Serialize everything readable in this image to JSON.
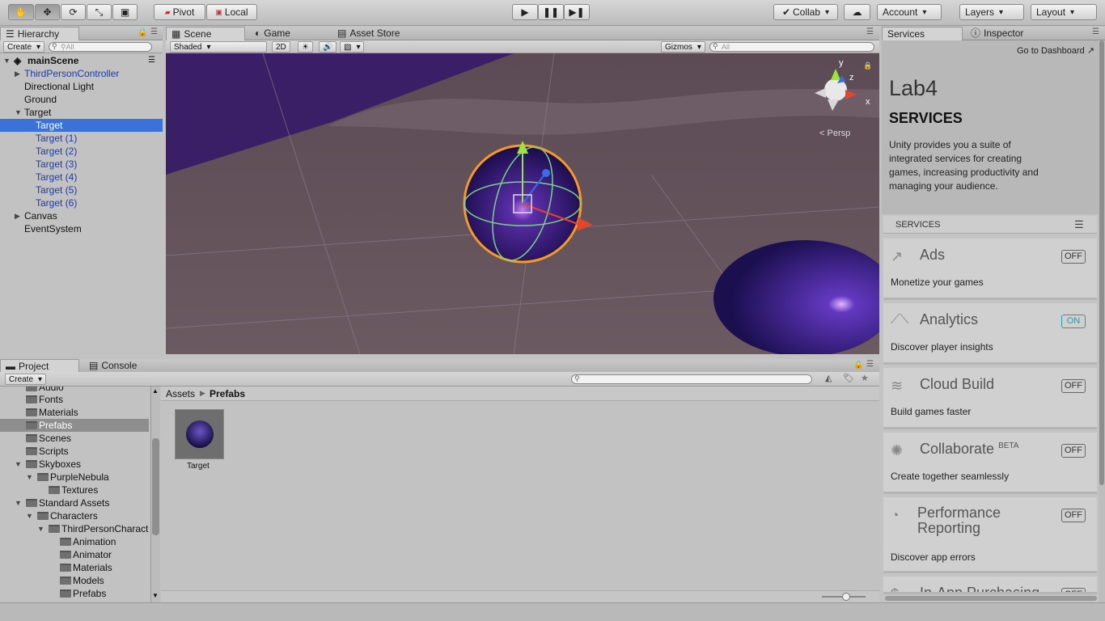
{
  "toolbar": {
    "pivot": "Pivot",
    "local": "Local",
    "collab": "Collab",
    "account": "Account",
    "layers": "Layers",
    "layout": "Layout"
  },
  "hierarchy": {
    "tab": "Hierarchy",
    "create": "Create",
    "search_placeholder": "⚲All",
    "scene": "mainScene",
    "items": [
      "ThirdPersonController",
      "Directional Light",
      "Ground",
      "Target",
      "Target",
      "Target (1)",
      "Target (2)",
      "Target (3)",
      "Target (4)",
      "Target (5)",
      "Target (6)",
      "Canvas",
      "EventSystem"
    ]
  },
  "scene": {
    "tabs": [
      "Scene",
      "Game",
      "Asset Store"
    ],
    "shading": "Shaded",
    "mode2d": "2D",
    "gizmos": "Gizmos",
    "search_placeholder": "All",
    "persp": "Persp",
    "axis_x": "x",
    "axis_y": "y",
    "axis_z": "z"
  },
  "services": {
    "tabs": [
      "Services",
      "Inspector"
    ],
    "dashboard": "Go to Dashboard",
    "project": "Lab4",
    "heading": "SERVICES",
    "intro": "Unity provides you a suite of integrated services for creating games, increasing productivity and managing your audience.",
    "section": "SERVICES",
    "cards": [
      {
        "title": "Ads",
        "desc": "Monetize your games",
        "state": "OFF"
      },
      {
        "title": "Analytics",
        "desc": "Discover player insights",
        "state": "ON"
      },
      {
        "title": "Cloud Build",
        "desc": "Build games faster",
        "state": "OFF"
      },
      {
        "title": "Collaborate",
        "badge": "BETA",
        "desc": "Create together seamlessly",
        "state": "OFF"
      },
      {
        "title": "Performance",
        "title2": "Reporting",
        "desc": "Discover app errors",
        "state": "OFF"
      },
      {
        "title": "In-App Purchasing",
        "state": "OFF"
      }
    ]
  },
  "project": {
    "tabs": [
      "Project",
      "Console"
    ],
    "create": "Create",
    "breadcrumb": [
      "Assets",
      "Prefabs"
    ],
    "asset": "Target",
    "tree": [
      "Audio",
      "Fonts",
      "Materials",
      "Prefabs",
      "Scenes",
      "Scripts",
      "Skyboxes",
      "PurpleNebula",
      "Textures",
      "Standard Assets",
      "Characters",
      "ThirdPersonCharact",
      "Animation",
      "Animator",
      "Materials",
      "Models",
      "Prefabs"
    ]
  },
  "colors": {
    "selection": "#3a72d8",
    "prefab_text": "#1c3aa8",
    "on_toggle": "#2a9aa5"
  }
}
